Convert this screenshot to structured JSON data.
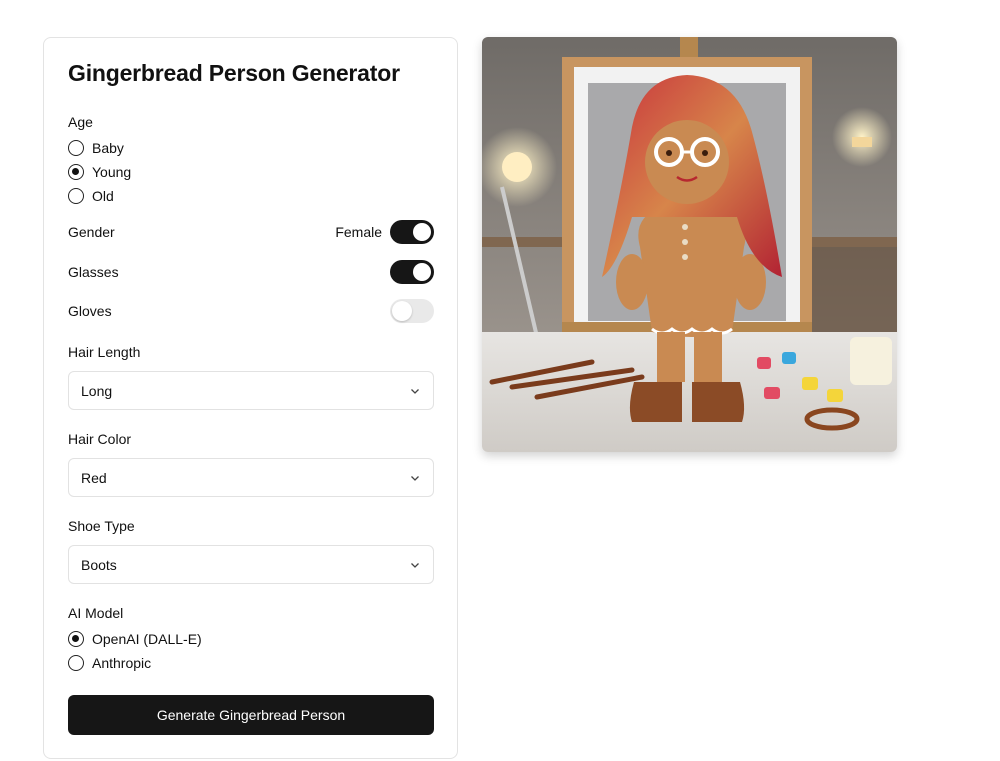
{
  "form": {
    "title": "Gingerbread Person Generator",
    "age": {
      "label": "Age",
      "options": [
        "Baby",
        "Young",
        "Old"
      ],
      "selected": "Young"
    },
    "gender": {
      "label": "Gender",
      "value_text": "Female",
      "on": true
    },
    "glasses": {
      "label": "Glasses",
      "on": true
    },
    "gloves": {
      "label": "Gloves",
      "on": false
    },
    "hair_length": {
      "label": "Hair Length",
      "value": "Long"
    },
    "hair_color": {
      "label": "Hair Color",
      "value": "Red"
    },
    "shoe_type": {
      "label": "Shoe Type",
      "value": "Boots"
    },
    "ai_model": {
      "label": "AI Model",
      "options": [
        "OpenAI (DALL-E)",
        "Anthropic"
      ],
      "selected": "OpenAI (DALL-E)"
    },
    "generate_label": "Generate Gingerbread Person"
  },
  "colors": {
    "accent": "#161616",
    "border": "#e3e3e3"
  }
}
